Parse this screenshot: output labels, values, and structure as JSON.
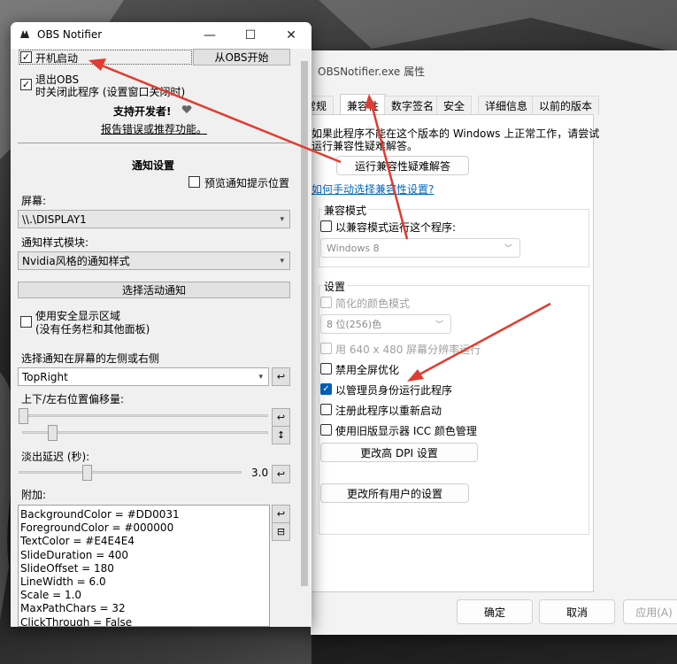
{
  "obs_window": {
    "title": "OBS Notifier",
    "controls": {
      "minimize": "—",
      "maximize": "☐",
      "close": "✕"
    },
    "startup_checkbox": {
      "label": "开机启动",
      "checked": true
    },
    "start_from_obs_button": "从OBS开始",
    "exit_obs_checkbox": {
      "line1": "退出OBS",
      "line2": "时关闭此程序 (设置窗口关闭时)",
      "checked": true
    },
    "support_dev_link": "支持开发者!",
    "report_bug_link": "报告错误或推荐功能。",
    "notification_settings_heading": "通知设置",
    "preview_position_checkbox": {
      "label": "预览通知提示位置",
      "checked": false
    },
    "screen_label": "屏幕:",
    "screen_value": "\\\\.\\DISPLAY1",
    "style_module_label": "通知样式模块:",
    "style_module_value": "Nvidia风格的通知样式",
    "select_active_button": "选择活动通知",
    "safe_area_checkbox": {
      "line1": "使用安全显示区域",
      "line2": "(没有任务栏和其他面板)",
      "checked": false
    },
    "side_label": "选择通知在屏幕的左侧或右侧",
    "side_value": "TopRight",
    "offset_label": "上下/左右位置偏移量:",
    "offset_h_fraction": 0.0,
    "offset_v_fraction": 0.11,
    "fade_label": "淡出延迟 (秒):",
    "fade_value": "3.0",
    "fade_fraction": 0.3,
    "addon_label": "附加:",
    "addon_lines": [
      "BackgroundColor = #DD0031",
      "ForegroundColor = #000000",
      "TextColor = #E4E4E4",
      "SlideDuration = 400",
      "SlideOffset = 180",
      "LineWidth = 6.0",
      "Scale = 1.0",
      "MaxPathChars = 32",
      "ClickThrough = False"
    ],
    "icons": {
      "reset": "↩",
      "swap": "↕",
      "toolbox": "⊟"
    }
  },
  "props_dialog": {
    "title": "OBSNotifier.exe 属性",
    "tabs": [
      "常规",
      "兼容性",
      "数字签名",
      "安全",
      "详细信息",
      "以前的版本"
    ],
    "active_tab": 1,
    "intro_line1": "如果此程序不能在这个版本的 Windows 上正常工作，请尝试",
    "intro_line2": "运行兼容性疑难解答。",
    "troubleshoot_button": "运行兼容性疑难解答",
    "manual_link": "如何手动选择兼容性设置?",
    "compat_mode_group": "兼容模式",
    "compat_mode_checkbox": "以兼容模式运行这个程序:",
    "compat_mode_value": "Windows 8",
    "settings_group": "设置",
    "reduced_color_checkbox": "简化的颜色模式",
    "color_value": "8 位(256)色",
    "res_640_checkbox": "用 640 x 480 屏幕分辨率运行",
    "disable_fullscreen_checkbox": "禁用全屏优化",
    "run_as_admin_checkbox": {
      "label": "以管理员身份运行此程序",
      "checked": true
    },
    "register_restart_checkbox": "注册此程序以重新启动",
    "legacy_icc_checkbox": "使用旧版显示器 ICC 颜色管理",
    "dpi_button": "更改高 DPI 设置",
    "all_users_button": "更改所有用户的设置",
    "ok_button": "确定",
    "cancel_button": "取消",
    "apply_button": "应用(A)"
  },
  "colors": {
    "arrow": "#e03c31",
    "accent": "#005fb8",
    "link": "#0067c0"
  }
}
